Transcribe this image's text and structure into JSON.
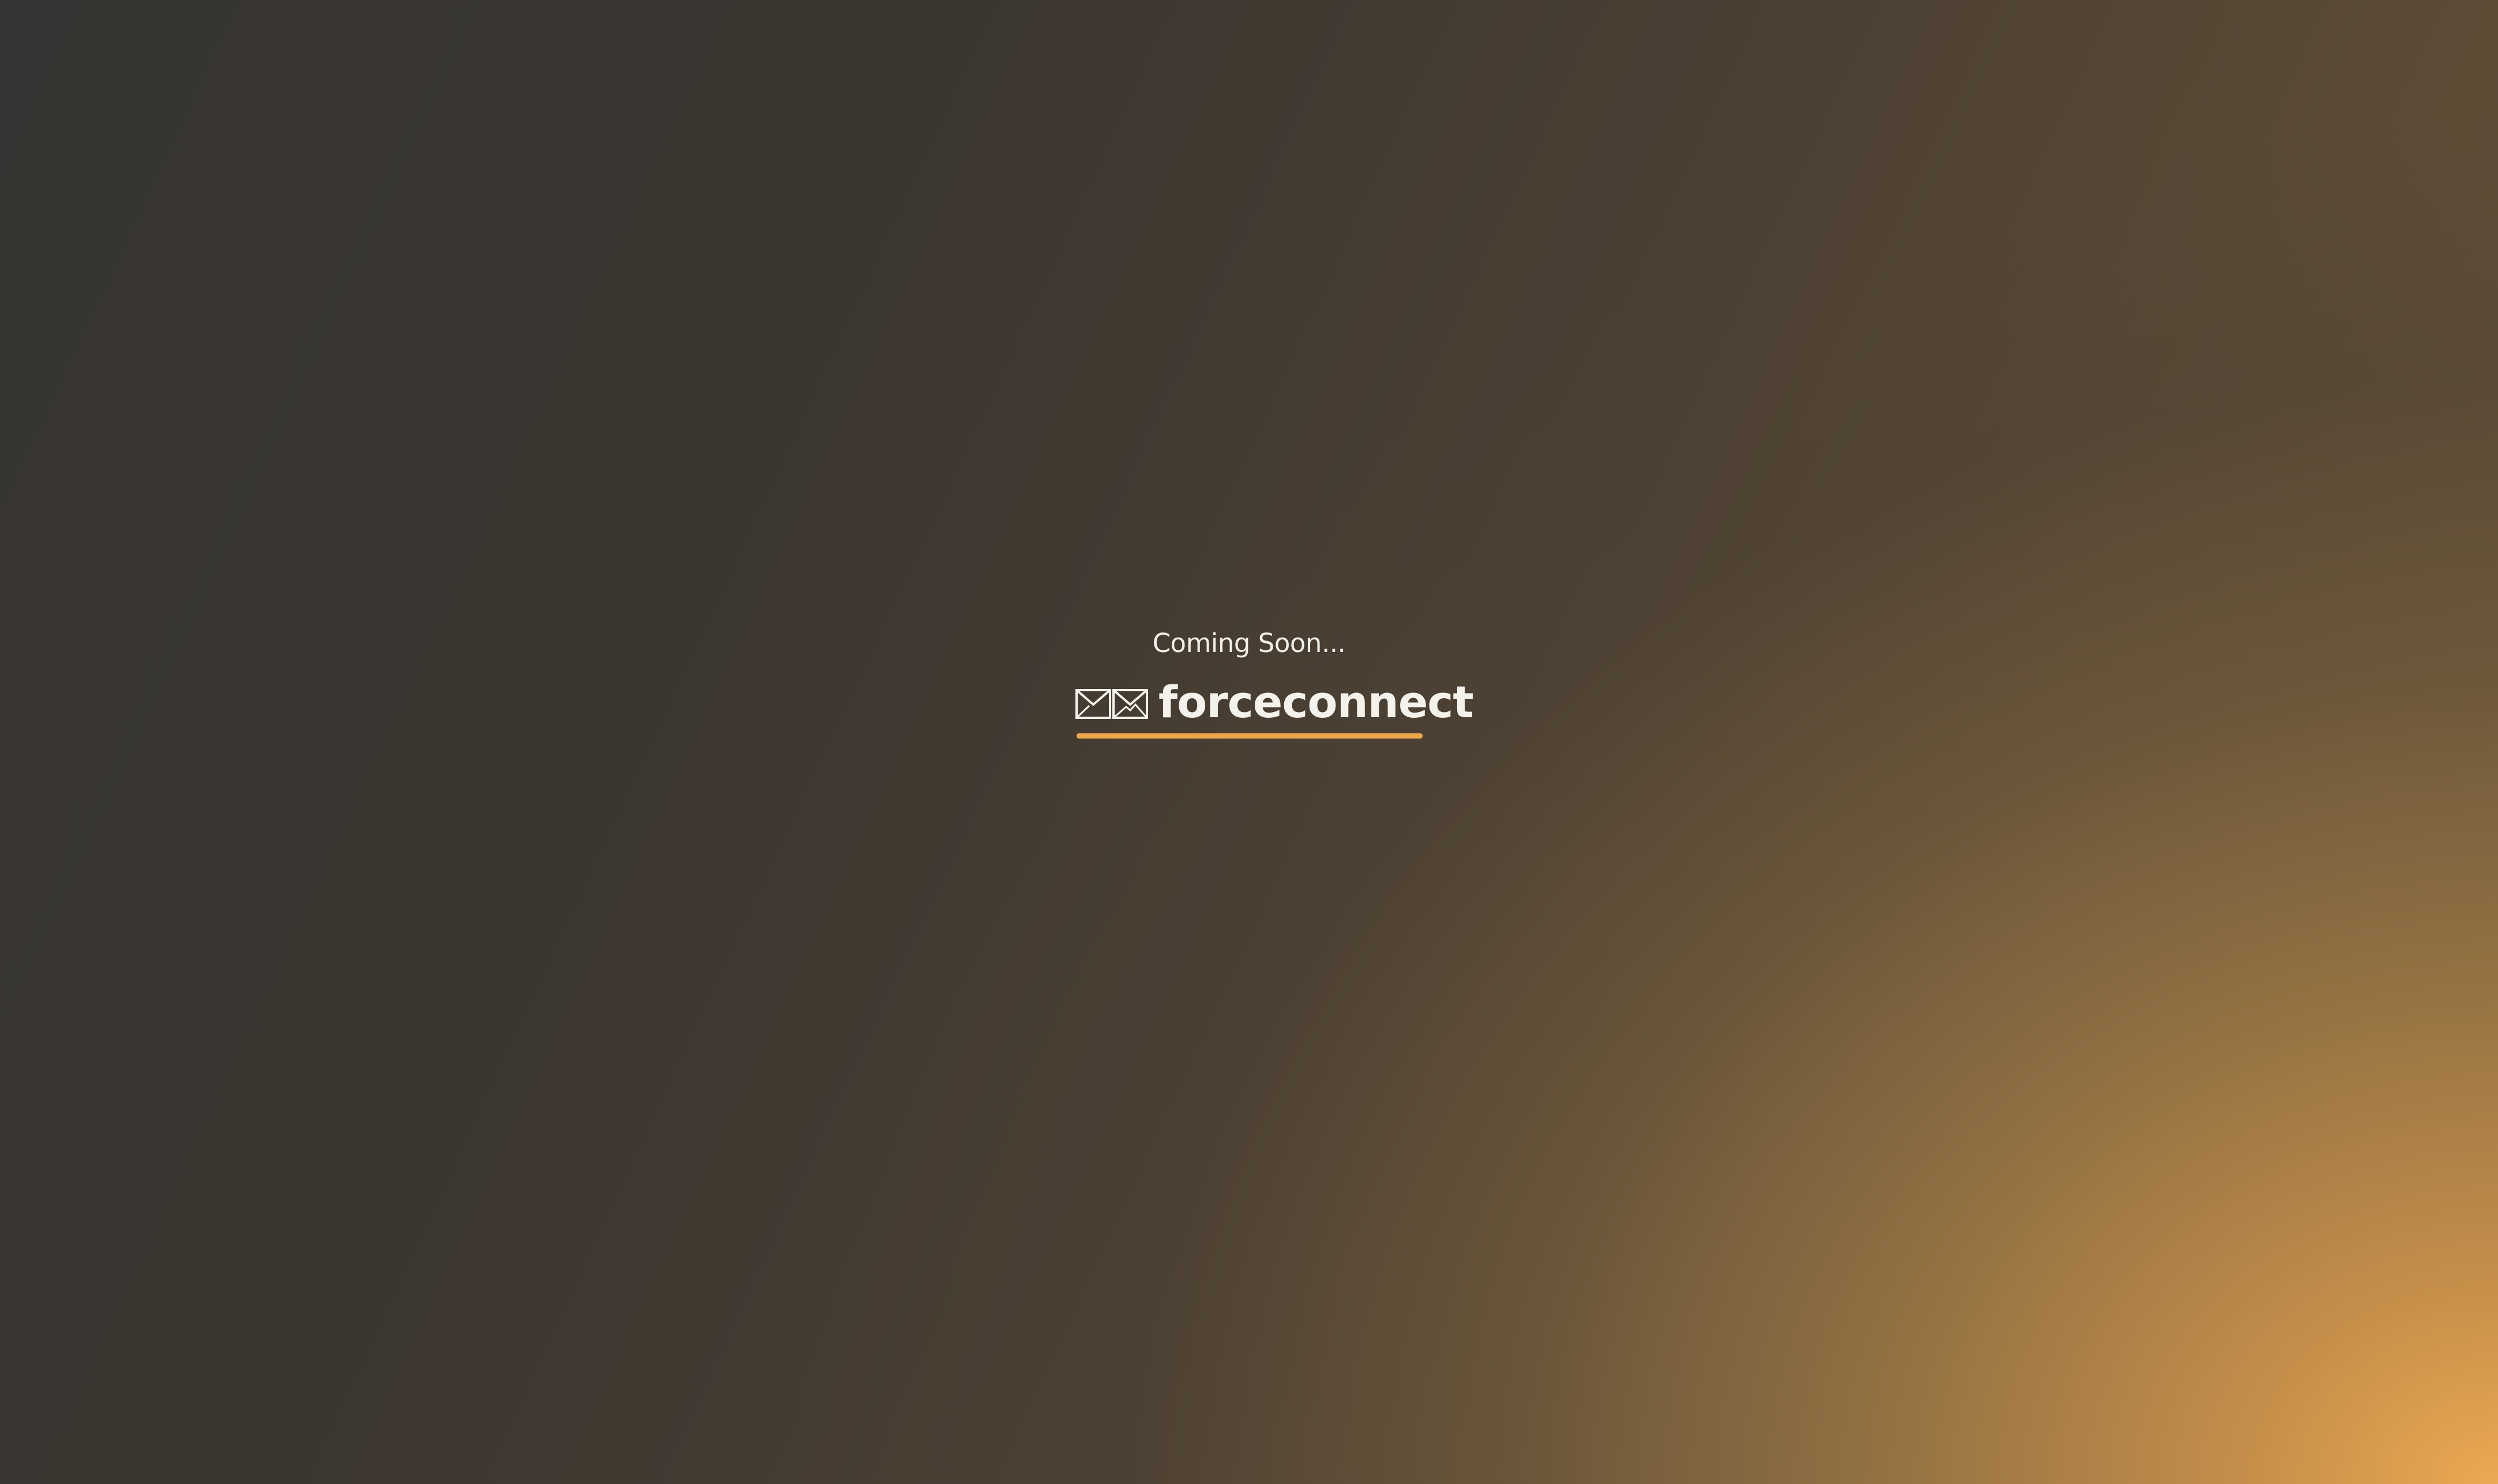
{
  "tagline": "Coming Soon...",
  "brand": {
    "name": "forceconnect",
    "icon": "envelopes-icon"
  },
  "colors": {
    "accent": "#eea64a",
    "text": "#f5f2ec",
    "background_dark": "#363533",
    "background_warm": "#eda852"
  }
}
